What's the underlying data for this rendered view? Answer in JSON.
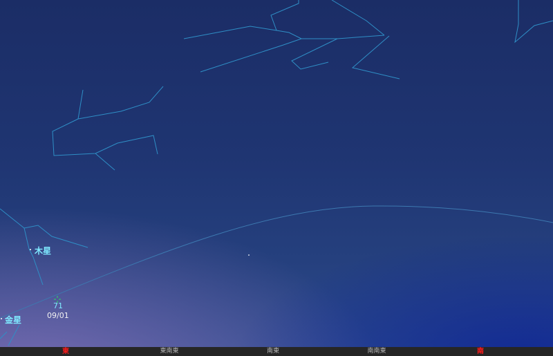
{
  "colors": {
    "constellation_line": "#2f8fc6",
    "ecliptic_line": "#3d79b0",
    "planet_label": "#7fe9ff",
    "target_marker": "#27e060",
    "cardinal_red": "#ff1a1a"
  },
  "planets": {
    "jupiter": {
      "label": "木星"
    },
    "venus": {
      "label": "金星"
    }
  },
  "target": {
    "number": "71",
    "date": "09/01"
  },
  "horizon": {
    "east": "東",
    "ese": "東南東",
    "se": "南東",
    "sse": "南南東",
    "south": "南"
  }
}
